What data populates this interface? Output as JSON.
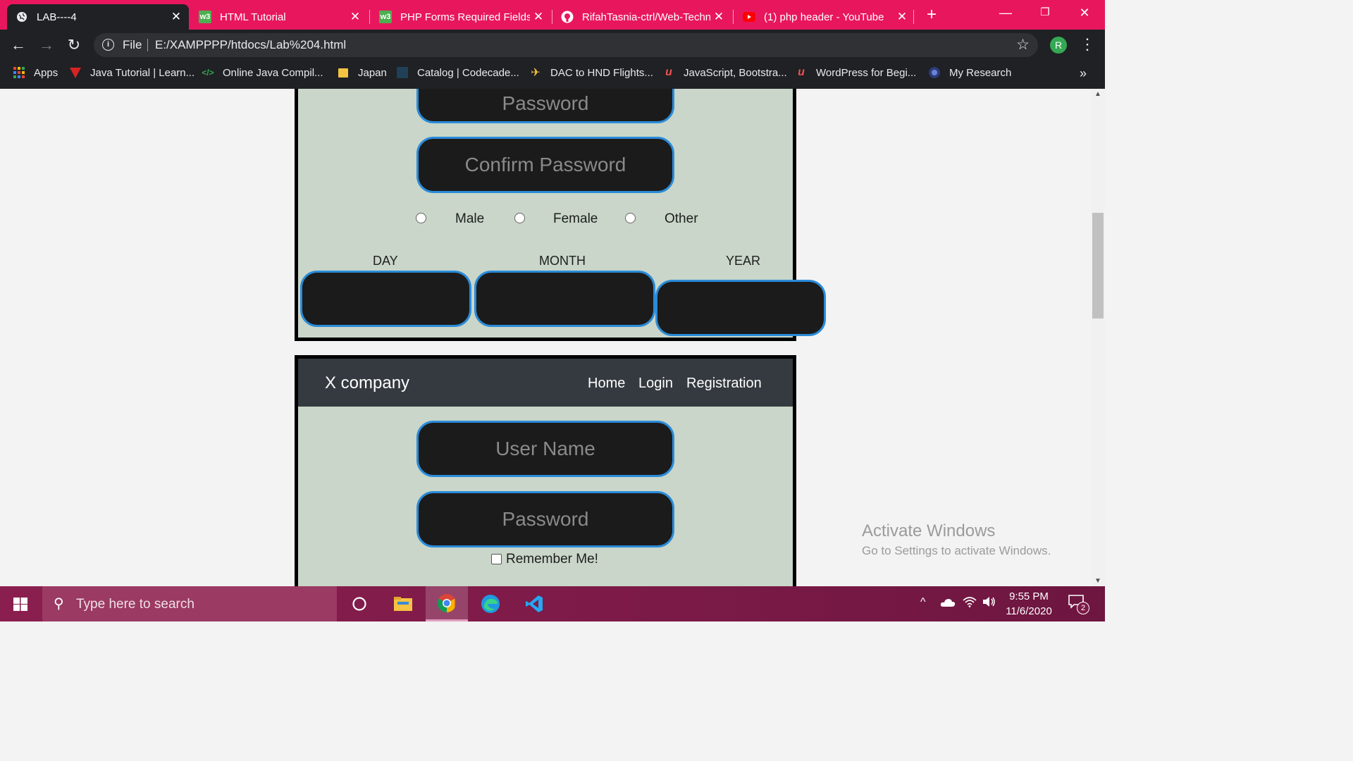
{
  "browser": {
    "tabs": [
      {
        "title": "LAB----4",
        "icon": "globe-icon",
        "active": true
      },
      {
        "title": "HTML Tutorial",
        "icon": "w3schools-icon",
        "active": false
      },
      {
        "title": "PHP Forms Required Fields",
        "icon": "w3schools-icon",
        "active": false
      },
      {
        "title": "RifahTasnia-ctrl/Web-Techn",
        "icon": "github-icon",
        "active": false
      },
      {
        "title": "(1) php header - YouTube",
        "icon": "youtube-icon",
        "active": false
      }
    ],
    "address": {
      "scheme_label": "File",
      "url": "E:/XAMPPPP/htdocs/Lab%204.html"
    },
    "profile_initial": "R",
    "bookmarks": [
      {
        "label": "Apps",
        "icon": "apps-grid-icon"
      },
      {
        "label": "Java Tutorial | Learn...",
        "icon": "java-bookmark-icon"
      },
      {
        "label": "Online Java Compil...",
        "icon": "code-bookmark-icon"
      },
      {
        "label": "Japan",
        "icon": "folder-icon"
      },
      {
        "label": "Catalog | Codecade...",
        "icon": "codecademy-icon"
      },
      {
        "label": "DAC to HND Flights...",
        "icon": "plane-icon"
      },
      {
        "label": "JavaScript, Bootstra...",
        "icon": "udemy-icon"
      },
      {
        "label": "WordPress for Begi...",
        "icon": "udemy-icon"
      },
      {
        "label": "My Research",
        "icon": "research-icon"
      }
    ],
    "bookmarks_more": "»"
  },
  "registration_form": {
    "password_placeholder": "Password",
    "confirm_password_placeholder": "Confirm Password",
    "gender_options": [
      "Male",
      "Female",
      "Other"
    ],
    "dob_labels": {
      "day": "DAY",
      "month": "MONTH",
      "year": "YEAR"
    }
  },
  "login_page": {
    "brand": "X company",
    "nav": [
      "Home",
      "Login",
      "Registration"
    ],
    "username_placeholder": "User Name",
    "password_placeholder": "Password",
    "remember_label": "Remember Me!"
  },
  "watermark": {
    "line1": "Activate Windows",
    "line2": "Go to Settings to activate Windows."
  },
  "taskbar": {
    "search_placeholder": "Type here to search",
    "time": "9:55 PM",
    "date": "11/6/2020",
    "notification_count": "2"
  },
  "colors": {
    "tab_strip": "#e8175d",
    "chrome_dark": "#202124",
    "form_bg": "#c9d6c9",
    "input_bg": "#1b1b1b",
    "input_border": "#2a8bd9",
    "navbar_bg": "#343a40"
  }
}
